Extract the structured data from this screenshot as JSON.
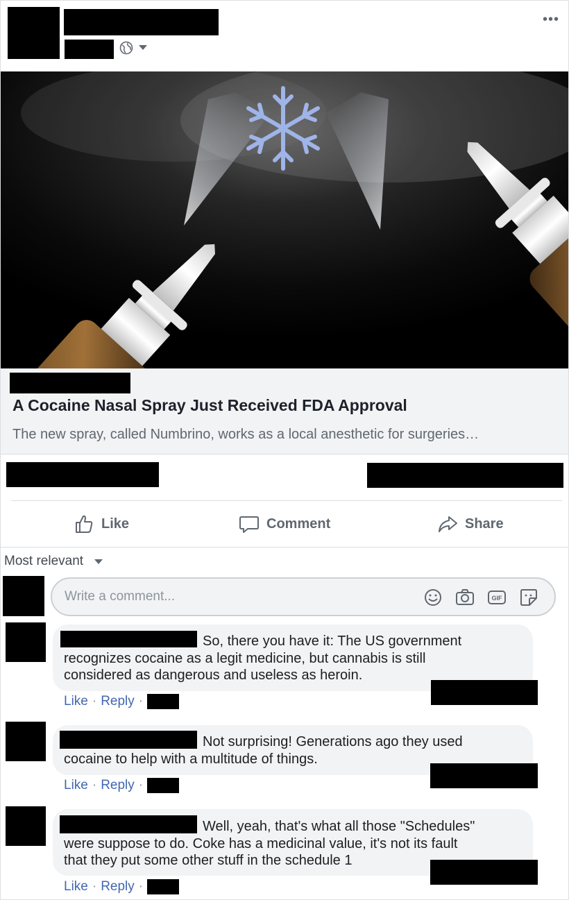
{
  "header": {
    "more_label": "•••",
    "privacy_icon": "globe-icon"
  },
  "link_preview": {
    "title": "A Cocaine Nasal Spray Just Received FDA Approval",
    "description": "The new spray, called Numbrino, works as a local anesthetic for surgeries",
    "image_icon": "snowflake-icon"
  },
  "actions": {
    "like": "Like",
    "comment": "Comment",
    "share": "Share"
  },
  "comments_section": {
    "sort_label": "Most relevant",
    "composer_placeholder": "Write a comment...",
    "composer_icons": [
      "emoji-icon",
      "camera-icon",
      "gif-icon",
      "sticker-icon"
    ]
  },
  "comments": [
    {
      "text_line1": "So, there you have it: The US government",
      "text_line2": "recognizes cocaine as a legit medicine, but cannabis is still",
      "text_line3": "considered as dangerous and useless as heroin.",
      "like": "Like",
      "reply": "Reply"
    },
    {
      "text_line1": "Not surprising! Generations ago they used",
      "text_line2": "cocaine to help with a multitude of things.",
      "like": "Like",
      "reply": "Reply"
    },
    {
      "text_line1": "Well, yeah, that's what all those \"Schedules\"",
      "text_line2": "were suppose to do. Coke has a medicinal value, it's not its fault",
      "text_line3": "that they put some other stuff in the schedule 1",
      "like": "Like",
      "reply": "Reply"
    }
  ],
  "colors": {
    "link_blue": "#4267b2",
    "muted_gray": "#606770",
    "bubble_bg": "#f2f3f5"
  }
}
